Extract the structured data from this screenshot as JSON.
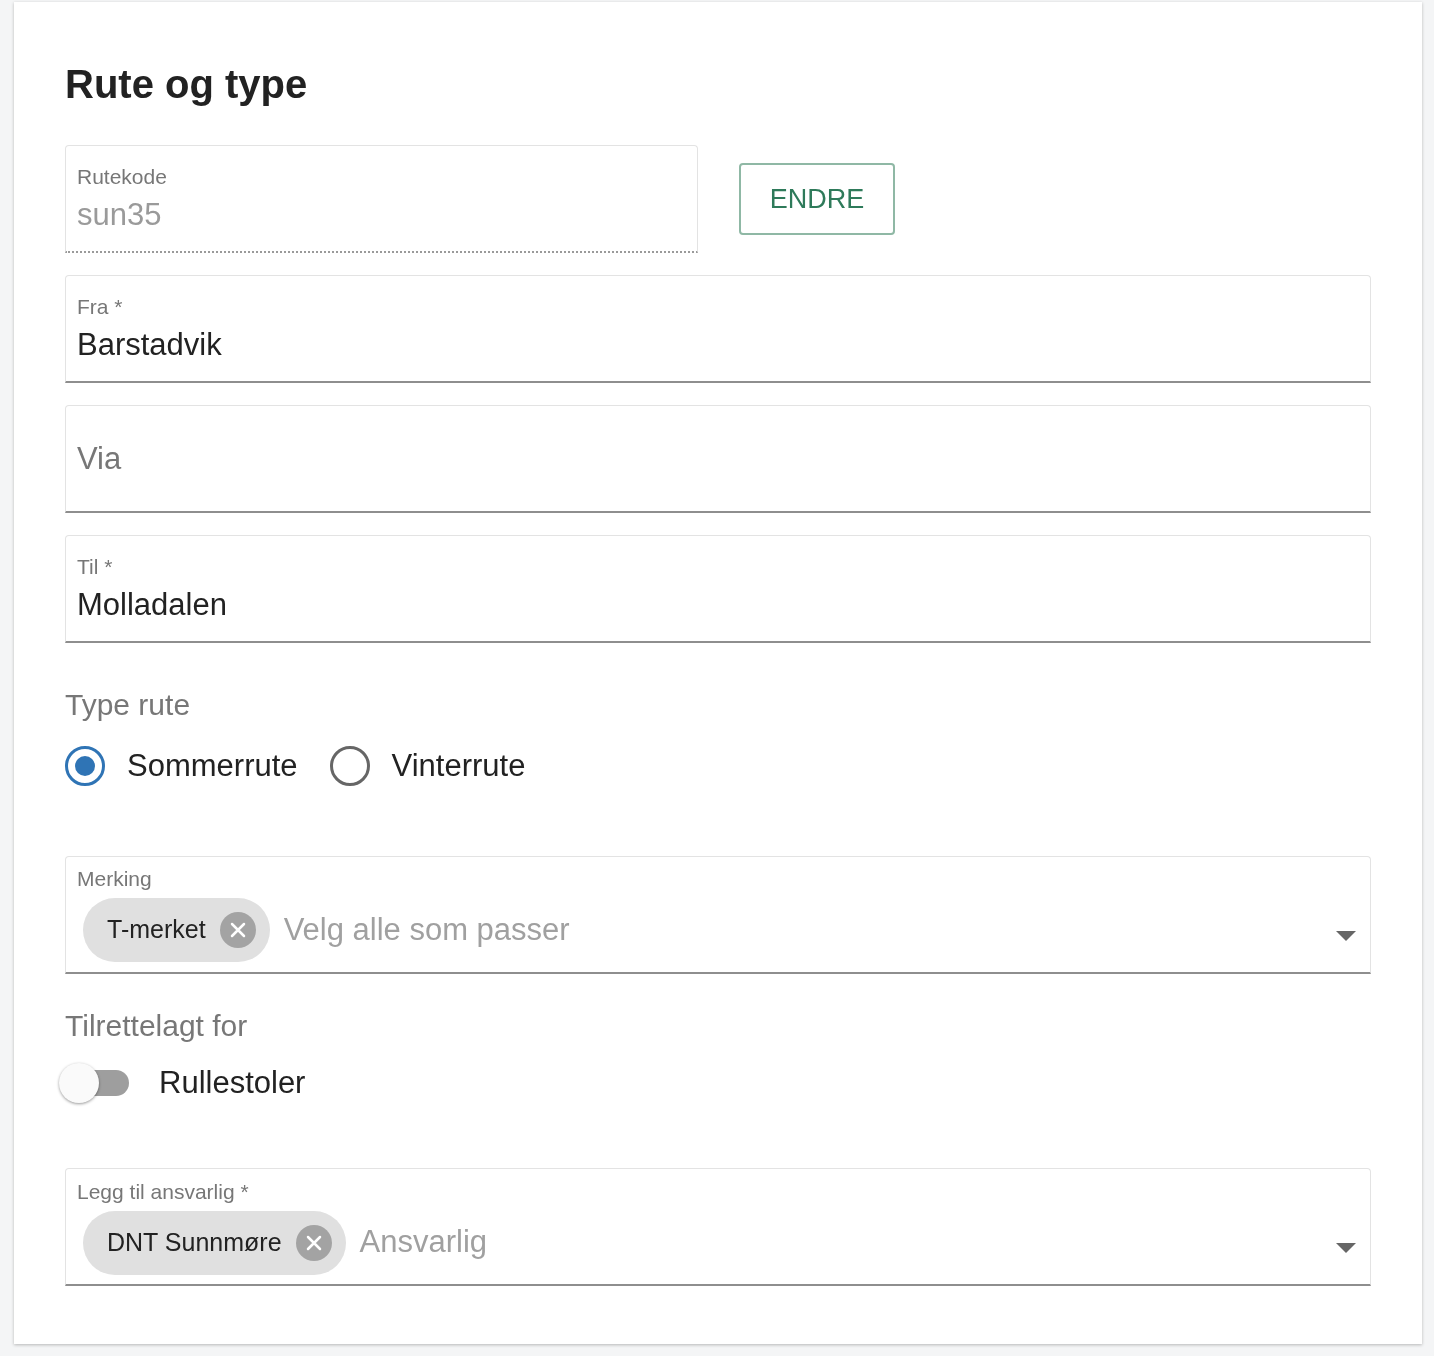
{
  "section": {
    "title": "Rute og type"
  },
  "route_code": {
    "label": "Rutekode",
    "value": "sun35",
    "disabled": true,
    "button": "ENDRE"
  },
  "text_fields": [
    {
      "label": "Fra *",
      "value": "Barstadvik"
    },
    {
      "label": "Via"
    },
    {
      "label": "Til *",
      "value": "Molladalen"
    }
  ],
  "route_type": {
    "label": "Type rute",
    "options": [
      {
        "label": "Sommerrute",
        "selected": true
      },
      {
        "label": "Vinterrute",
        "selected": false
      }
    ]
  },
  "marking": {
    "label": "Merking",
    "chips": [
      "T-merket"
    ],
    "placeholder": "Velg alle som passer"
  },
  "accessibility": {
    "label": "Tilrettelagt for",
    "toggles": [
      {
        "label": "Rullestoler",
        "on": false
      }
    ]
  },
  "responsible": {
    "label": "Legg til ansvarlig *",
    "chips": [
      "DNT Sunnmøre"
    ],
    "placeholder": "Ansvarlig"
  }
}
